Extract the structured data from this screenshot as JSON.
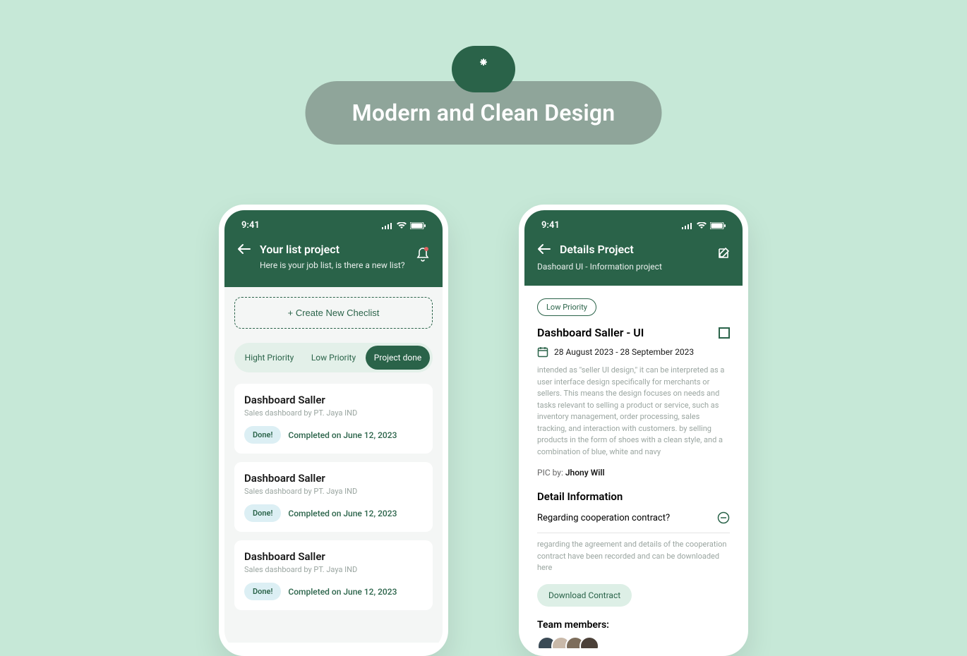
{
  "hero": {
    "title": "Modern and Clean Design"
  },
  "phone1": {
    "time": "9:41",
    "title": "Your list project",
    "subtitle": "Here is your job list, is there a new list?",
    "create_label": "+ Create New Checlist",
    "tabs": {
      "high": "Hight Priority",
      "low": "Low Priority",
      "done": "Project done"
    },
    "cards": [
      {
        "title": "Dashboard Saller",
        "sub": "Sales dashboard by PT. Jaya IND",
        "done": "Done!",
        "completed": "Completed on June 12, 2023"
      },
      {
        "title": "Dashboard Saller",
        "sub": "Sales dashboard by PT. Jaya IND",
        "done": "Done!",
        "completed": "Completed on June 12, 2023"
      },
      {
        "title": "Dashboard Saller",
        "sub": "Sales dashboard by PT. Jaya IND",
        "done": "Done!",
        "completed": "Completed on June 12, 2023"
      }
    ]
  },
  "phone2": {
    "time": "9:41",
    "title": "Details Project",
    "subtitle": "Dashoard UI - Information project",
    "low_label": "Low Priority",
    "project_title": "Dashboard Saller - UI",
    "date_range": "28 August 2023 - 28 September 2023",
    "desc": "intended as \"seller UI design,\" it can be interpreted as a user interface design specifically for merchants or sellers. This means the design focuses on needs and tasks relevant to selling a product or service, such as inventory management, order processing, sales tracking, and interaction with customers. by selling products in the form of shoes with a clean style, and a combination of blue, white and navy",
    "pic_label": "PIC by:",
    "pic_name": "Jhony Will",
    "detail_h": "Detail Information",
    "accordion_title": "Regarding cooperation contract?",
    "accordion_desc": "regarding the agreement and details of the cooperation contract have been recorded and can be downloaded here",
    "download_label": "Download Contract",
    "team_h": "Team members:"
  }
}
